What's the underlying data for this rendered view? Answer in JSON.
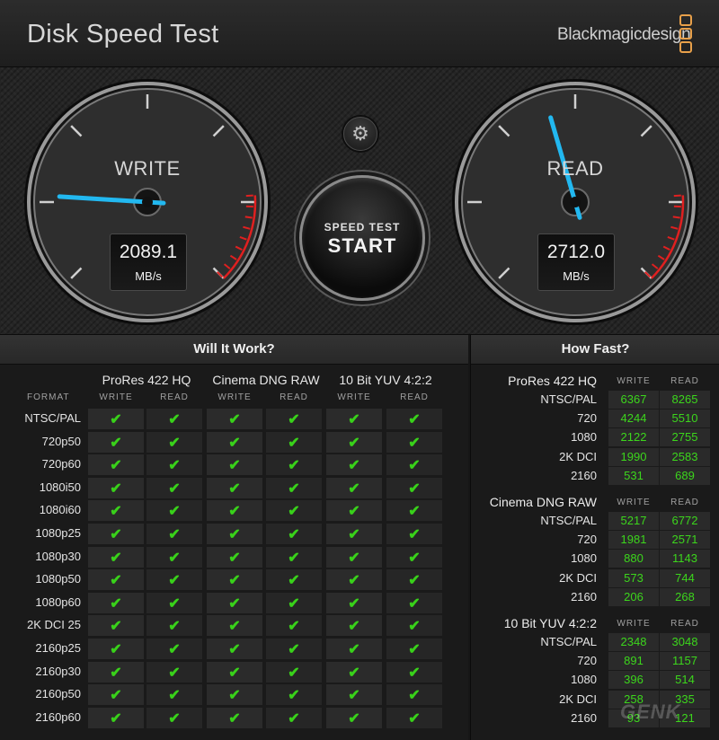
{
  "app": {
    "title": "Disk Speed Test",
    "brand": "Blackmagicdesign",
    "watermark": "GENK"
  },
  "colors": {
    "needle": "#22b8f0",
    "check": "#39d11a",
    "value": "#3cd61c",
    "redzone": "#e02020",
    "brand_logo": "#e8a04a"
  },
  "gauges": {
    "write": {
      "label": "WRITE",
      "value": "2089.1",
      "unit": "MB/s",
      "needle_fraction": 0.18
    },
    "read": {
      "label": "READ",
      "value": "2712.0",
      "unit": "MB/s",
      "needle_fraction": 0.44
    }
  },
  "controls": {
    "settings_icon": "gear-icon",
    "start_top": "SPEED TEST",
    "start_main": "START"
  },
  "will_it_work": {
    "title": "Will It Work?",
    "format_header": "FORMAT",
    "groups": [
      {
        "name": "ProRes 422 HQ",
        "write": "WRITE",
        "read": "READ"
      },
      {
        "name": "Cinema DNG RAW",
        "write": "WRITE",
        "read": "READ"
      },
      {
        "name": "10 Bit YUV 4:2:2",
        "write": "WRITE",
        "read": "READ"
      }
    ],
    "check_symbol": "✔",
    "rows": [
      {
        "format": "NTSC/PAL",
        "checks": [
          true,
          true,
          true,
          true,
          true,
          true
        ]
      },
      {
        "format": "720p50",
        "checks": [
          true,
          true,
          true,
          true,
          true,
          true
        ]
      },
      {
        "format": "720p60",
        "checks": [
          true,
          true,
          true,
          true,
          true,
          true
        ]
      },
      {
        "format": "1080i50",
        "checks": [
          true,
          true,
          true,
          true,
          true,
          true
        ]
      },
      {
        "format": "1080i60",
        "checks": [
          true,
          true,
          true,
          true,
          true,
          true
        ]
      },
      {
        "format": "1080p25",
        "checks": [
          true,
          true,
          true,
          true,
          true,
          true
        ]
      },
      {
        "format": "1080p30",
        "checks": [
          true,
          true,
          true,
          true,
          true,
          true
        ]
      },
      {
        "format": "1080p50",
        "checks": [
          true,
          true,
          true,
          true,
          true,
          true
        ]
      },
      {
        "format": "1080p60",
        "checks": [
          true,
          true,
          true,
          true,
          true,
          true
        ]
      },
      {
        "format": "2K DCI 25",
        "checks": [
          true,
          true,
          true,
          true,
          true,
          true
        ]
      },
      {
        "format": "2160p25",
        "checks": [
          true,
          true,
          true,
          true,
          true,
          true
        ]
      },
      {
        "format": "2160p30",
        "checks": [
          true,
          true,
          true,
          true,
          true,
          true
        ]
      },
      {
        "format": "2160p50",
        "checks": [
          true,
          true,
          true,
          true,
          true,
          true
        ]
      },
      {
        "format": "2160p60",
        "checks": [
          true,
          true,
          true,
          true,
          true,
          true
        ]
      }
    ]
  },
  "how_fast": {
    "title": "How Fast?",
    "groups": [
      {
        "name": "ProRes 422 HQ",
        "write": "WRITE",
        "read": "READ",
        "rows": [
          {
            "label": "NTSC/PAL",
            "write": "6367",
            "read": "8265"
          },
          {
            "label": "720",
            "write": "4244",
            "read": "5510"
          },
          {
            "label": "1080",
            "write": "2122",
            "read": "2755"
          },
          {
            "label": "2K DCI",
            "write": "1990",
            "read": "2583"
          },
          {
            "label": "2160",
            "write": "531",
            "read": "689"
          }
        ]
      },
      {
        "name": "Cinema DNG RAW",
        "write": "WRITE",
        "read": "READ",
        "rows": [
          {
            "label": "NTSC/PAL",
            "write": "5217",
            "read": "6772"
          },
          {
            "label": "720",
            "write": "1981",
            "read": "2571"
          },
          {
            "label": "1080",
            "write": "880",
            "read": "1143"
          },
          {
            "label": "2K DCI",
            "write": "573",
            "read": "744"
          },
          {
            "label": "2160",
            "write": "206",
            "read": "268"
          }
        ]
      },
      {
        "name": "10 Bit YUV 4:2:2",
        "write": "WRITE",
        "read": "READ",
        "rows": [
          {
            "label": "NTSC/PAL",
            "write": "2348",
            "read": "3048"
          },
          {
            "label": "720",
            "write": "891",
            "read": "1157"
          },
          {
            "label": "1080",
            "write": "396",
            "read": "514"
          },
          {
            "label": "2K DCI",
            "write": "258",
            "read": "335"
          },
          {
            "label": "2160",
            "write": "93",
            "read": "121"
          }
        ]
      }
    ]
  }
}
